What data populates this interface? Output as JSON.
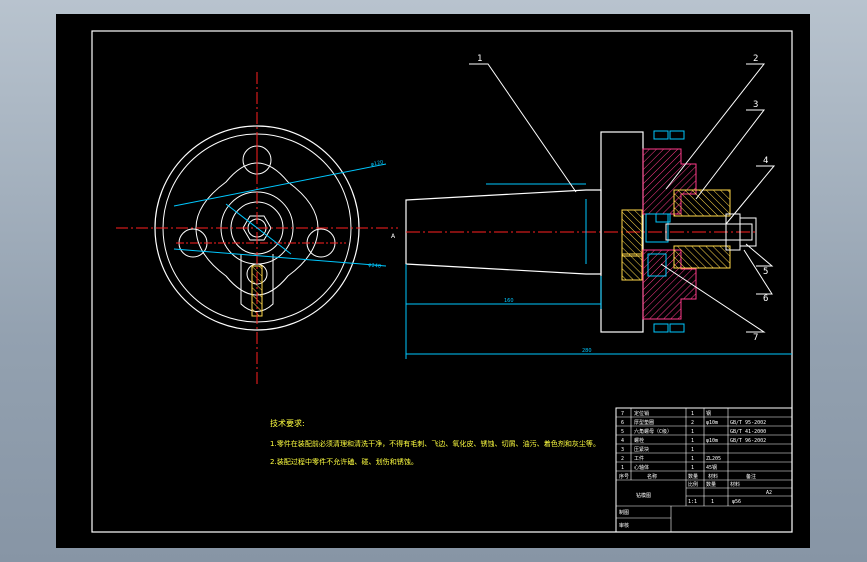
{
  "colors": {
    "background": "#000000",
    "frame": "#ffffff",
    "centerline": "#ff2020",
    "dimension": "#00c8ff",
    "hatch_section": "#ff3a8a",
    "hatch_body": "#ffd84a",
    "part": "#ffffff",
    "leader": "#ffffff",
    "tech_text": "#ffff40"
  },
  "balloons": [
    "1",
    "2",
    "3",
    "4",
    "5",
    "6",
    "7"
  ],
  "technical_requirements": {
    "title": "技术要求:",
    "items": [
      "1.零件在装配前必须清理和清洗干净，不得有毛刺、飞边、氧化皮、锈蚀、切屑、油污、着色剂和灰尘等。",
      "2.装配过程中零件不允许磕、碰、划伤和锈蚀。"
    ]
  },
  "bom": {
    "rows": [
      {
        "no": "7",
        "name": "定位销",
        "qty": "1",
        "material": "钢",
        "remark": ""
      },
      {
        "no": "6",
        "name": "厚型垫圈",
        "qty": "2",
        "material": "φ10m",
        "remark": "GB/T 95-2002"
      },
      {
        "no": "5",
        "name": "六角螺母（C级）",
        "qty": "1",
        "material": "",
        "remark": "GB/T 41-2000"
      },
      {
        "no": "4",
        "name": "螺栓",
        "qty": "1",
        "material": "φ10m",
        "remark": "GB/T 96-2002"
      },
      {
        "no": "3",
        "name": "压紧块",
        "qty": "1",
        "material": "",
        "remark": ""
      },
      {
        "no": "2",
        "name": "工件",
        "qty": "1",
        "material": "ZL205",
        "remark": ""
      },
      {
        "no": "1",
        "name": "心轴体",
        "qty": "1",
        "material": "45钢",
        "remark": ""
      }
    ],
    "header": {
      "no": "序号",
      "name": "名称",
      "qty": "数量",
      "material": "材料",
      "remark": "备注"
    },
    "title_block": {
      "drawing_name": "钻模图",
      "scale_label": "比例",
      "quantity_label": "数量",
      "material_label": "材料",
      "sheet_no": "A2",
      "scale_value": "1:1",
      "quantity_value": "1",
      "material_value": "φ56",
      "drawn_label": "制图",
      "checked_label": "审核"
    }
  }
}
